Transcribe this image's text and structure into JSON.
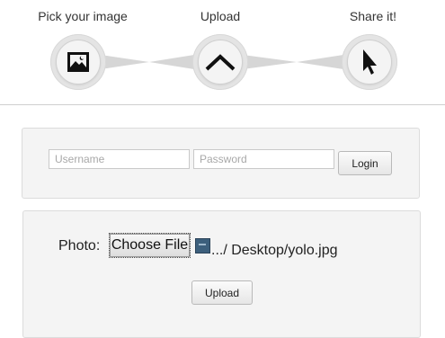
{
  "steps": [
    {
      "label": "Pick your image",
      "icon": "image-icon"
    },
    {
      "label": "Upload",
      "icon": "chevron-up-icon"
    },
    {
      "label": "Share it!",
      "icon": "cursor-arrow-icon"
    }
  ],
  "login": {
    "username_placeholder": "Username",
    "password_placeholder": "Password",
    "login_label": "Login"
  },
  "upload_form": {
    "photo_label": "Photo:",
    "choose_file_label": "Choose File",
    "file_name": ".../ Desktop/yolo.jpg",
    "upload_label": "Upload"
  },
  "colors": {
    "panel_background": "#f4f4f4",
    "step_circle": "#e4e4e4",
    "connector": "#d6d6d6"
  }
}
